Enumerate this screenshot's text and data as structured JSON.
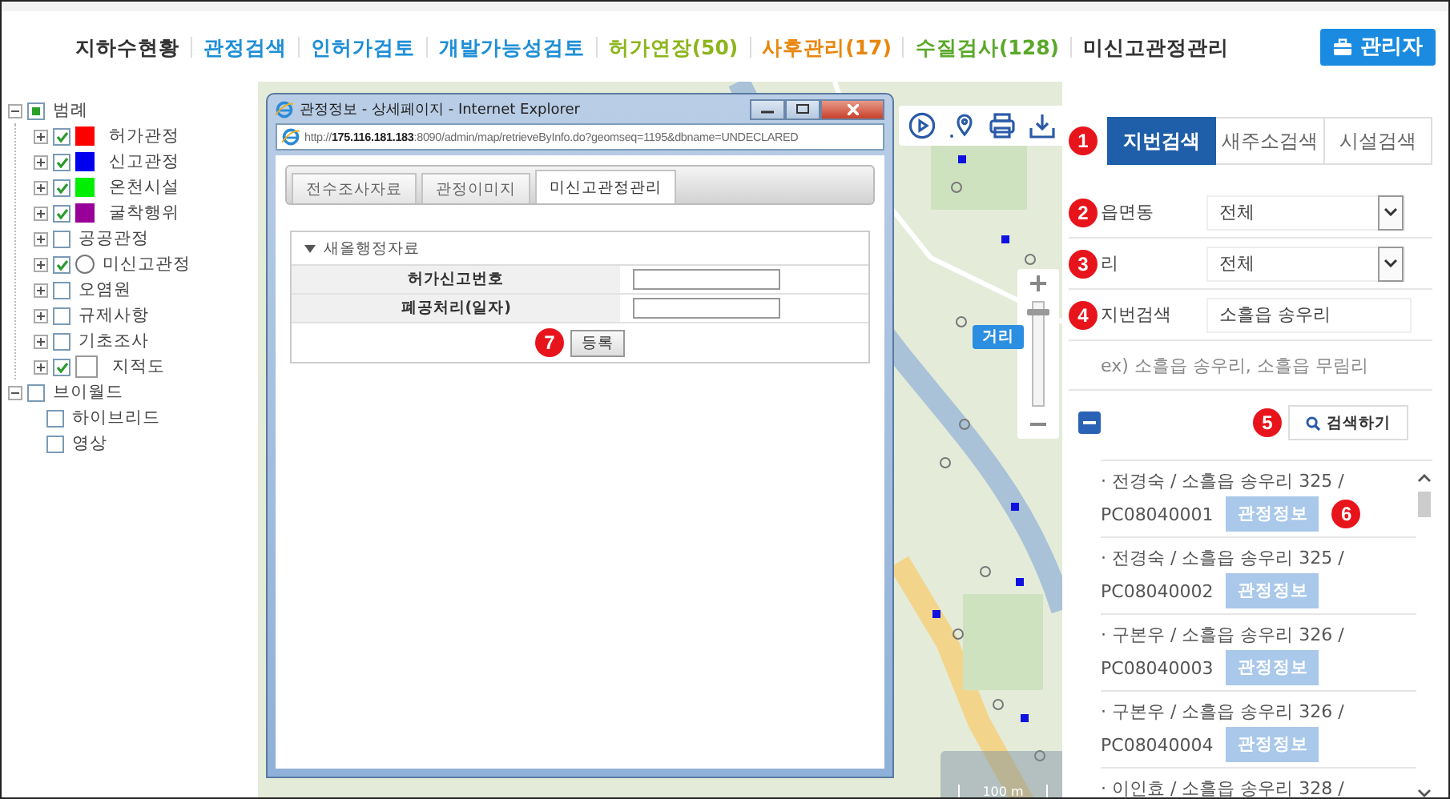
{
  "header": {
    "nav": [
      {
        "label": "지하수현황",
        "color": "#333333"
      },
      {
        "label": "관정검색",
        "color": "#1e8fd6"
      },
      {
        "label": "인허가검토",
        "color": "#1e8fd6"
      },
      {
        "label": "개발가능성검토",
        "color": "#1e8fd6"
      },
      {
        "label": "허가연장(50)",
        "color": "#8db51c"
      },
      {
        "label": "사후관리(17)",
        "color": "#e8860c"
      },
      {
        "label": "수질검사(128)",
        "color": "#5aa829"
      },
      {
        "label": "미신고관정관리",
        "color": "#333333"
      }
    ],
    "admin_button": "관리자"
  },
  "legend": [
    {
      "label": "범례",
      "expanded": true,
      "checked": true,
      "indeterminate": true,
      "children": [
        {
          "label": "허가관정",
          "expanded": false,
          "checked": true,
          "kind": "swatch",
          "color": "#ff0000"
        },
        {
          "label": "신고관정",
          "expanded": false,
          "checked": true,
          "kind": "swatch",
          "color": "#0000ee"
        },
        {
          "label": "온천시설",
          "expanded": false,
          "checked": true,
          "kind": "swatch",
          "color": "#00ee00"
        },
        {
          "label": "굴착행위",
          "expanded": false,
          "checked": true,
          "kind": "swatch",
          "color": "#990099"
        },
        {
          "label": "공공관정",
          "expanded": false,
          "checked": false,
          "kind": "none"
        },
        {
          "label": "미신고관정",
          "expanded": false,
          "checked": true,
          "kind": "circle"
        },
        {
          "label": "오염원",
          "expanded": false,
          "checked": false,
          "kind": "none"
        },
        {
          "label": "규제사항",
          "expanded": false,
          "checked": false,
          "kind": "none"
        },
        {
          "label": "기초조사",
          "expanded": false,
          "checked": false,
          "kind": "none"
        },
        {
          "label": "지적도",
          "expanded": false,
          "checked": true,
          "kind": "blank"
        }
      ]
    },
    {
      "label": "브이월드",
      "expanded": true,
      "checked": false,
      "indeterminate": false,
      "children": [
        {
          "label": "하이브리드",
          "checked": false
        },
        {
          "label": "영상",
          "checked": false
        }
      ]
    }
  ],
  "map": {
    "zoom": {
      "level": 0.9
    },
    "distance_tag": "거리",
    "scale_bar": "100 m"
  },
  "popup": {
    "title": "관정정보 - 상세페이지 - Internet Explorer",
    "url": "http://**175.116.181.183**:8090/admin/map/retrieveByInfo.do?geomseq=1195&dbname=UNDECLARED",
    "tabs": [
      {
        "label": "전수조사자료",
        "selected": false
      },
      {
        "label": "관정이미지",
        "selected": false
      },
      {
        "label": "미신고관정관리",
        "selected": true
      }
    ],
    "section": {
      "title": "새올행정자료",
      "expanded": true,
      "fields": [
        {
          "label": "허가신고번호"
        },
        {
          "label": "폐공처리(일자)"
        }
      ]
    },
    "submit": {
      "marker": "7",
      "label": "등록"
    }
  },
  "search_panel": {
    "marker": "1",
    "tabs": [
      {
        "label": "지번검색",
        "selected": true
      },
      {
        "label": "새주소검색",
        "selected": false
      },
      {
        "label": "시설검색",
        "selected": false
      }
    ],
    "fields": [
      {
        "kind": "select",
        "marker": "2",
        "label": "읍면동",
        "value": "전체"
      },
      {
        "kind": "select",
        "marker": "3",
        "label": "리",
        "value": "전체"
      },
      {
        "kind": "input",
        "marker": "4",
        "label": "지번검색",
        "value": "소흘읍 송우리"
      }
    ],
    "hint": "ex) 소흘읍 송우리, 소흘읍 무림리",
    "search_button": {
      "marker": "5",
      "label": "검색하기"
    },
    "results": [
      {
        "line": "· 전경숙 / 소흘읍 송우리 325 /",
        "id": "PC08040001",
        "button": "관정정보",
        "marker": "6"
      },
      {
        "line": "· 전경숙 / 소흘읍 송우리 325 /",
        "id": "PC08040002",
        "button": "관정정보"
      },
      {
        "line": "· 구본우 / 소흘읍 송우리 326 /",
        "id": "PC08040003",
        "button": "관정정보"
      },
      {
        "line": "· 구본우 / 소흘읍 송우리 326 /",
        "id": "PC08040004",
        "button": "관정정보"
      },
      {
        "line": "· 이인효 / 소흘읍 송우리 328 /"
      }
    ]
  }
}
